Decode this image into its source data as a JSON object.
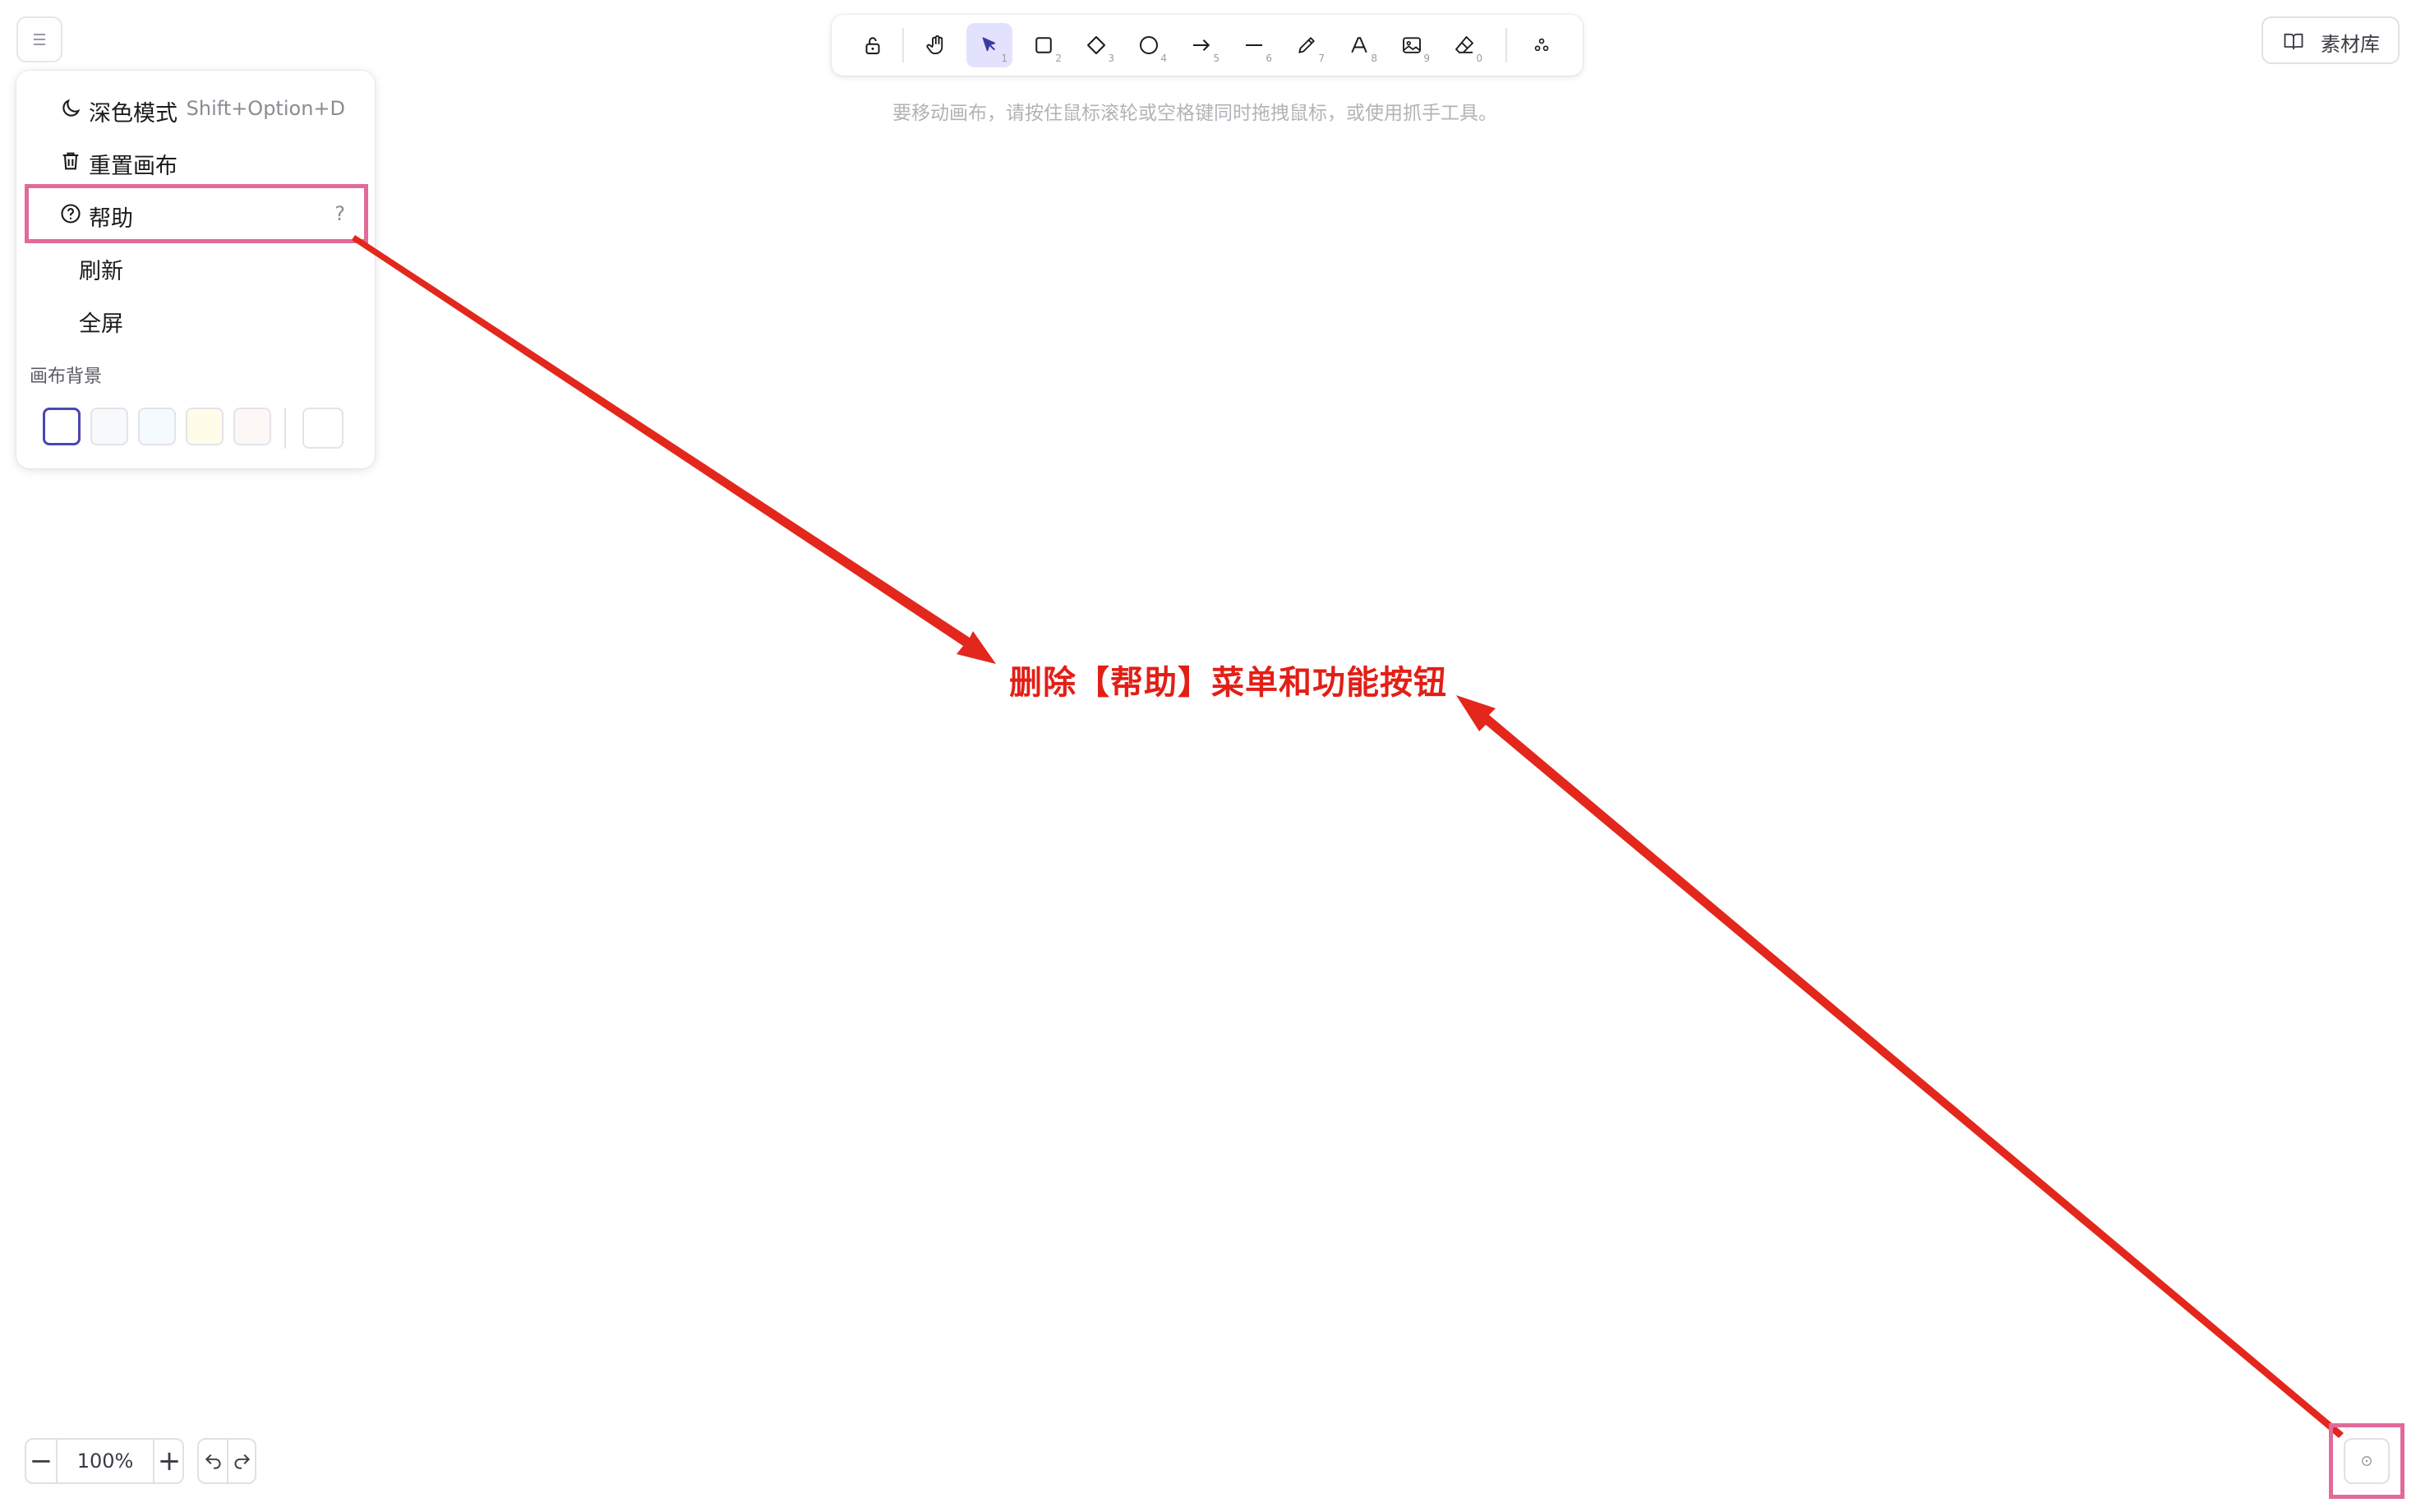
{
  "menu": {
    "items": [
      {
        "label": "深色模式",
        "shortcut": "Shift+Option+D",
        "icon": "moon-icon"
      },
      {
        "label": "重置画布",
        "shortcut": "",
        "icon": "trash-icon"
      },
      {
        "label": "帮助",
        "shortcut": "?",
        "icon": "help-circle-icon"
      },
      {
        "label": "刷新",
        "shortcut": "",
        "icon": ""
      },
      {
        "label": "全屏",
        "shortcut": "",
        "icon": ""
      }
    ],
    "canvas_bg_label": "画布背景",
    "swatches": [
      "#ffffff",
      "#f8f9fa",
      "#f5faff",
      "#fffce8",
      "#fdf8f6"
    ],
    "custom_swatch": "#ffffff"
  },
  "toolbar": {
    "tools": [
      {
        "name": "lock",
        "num": ""
      },
      {
        "name": "hand",
        "num": ""
      },
      {
        "name": "selection",
        "num": "1"
      },
      {
        "name": "rectangle",
        "num": "2"
      },
      {
        "name": "diamond",
        "num": "3"
      },
      {
        "name": "ellipse",
        "num": "4"
      },
      {
        "name": "arrow",
        "num": "5"
      },
      {
        "name": "line",
        "num": "6"
      },
      {
        "name": "draw",
        "num": "7"
      },
      {
        "name": "text",
        "num": "8"
      },
      {
        "name": "image",
        "num": "9"
      },
      {
        "name": "eraser",
        "num": "0"
      },
      {
        "name": "extra",
        "num": ""
      }
    ],
    "active": "selection"
  },
  "hint": "要移动画布，请按住鼠标滚轮或空格键同时拖拽鼠标，或使用抓手工具。",
  "library_label": "素材库",
  "annotation": "删除【帮助】菜单和功能按钮",
  "zoom": {
    "value": "100%",
    "minus": "−",
    "plus": "+"
  },
  "colors": {
    "accent": "#6965db",
    "highlight": "#e26a99",
    "annotation": "#e21f17"
  }
}
